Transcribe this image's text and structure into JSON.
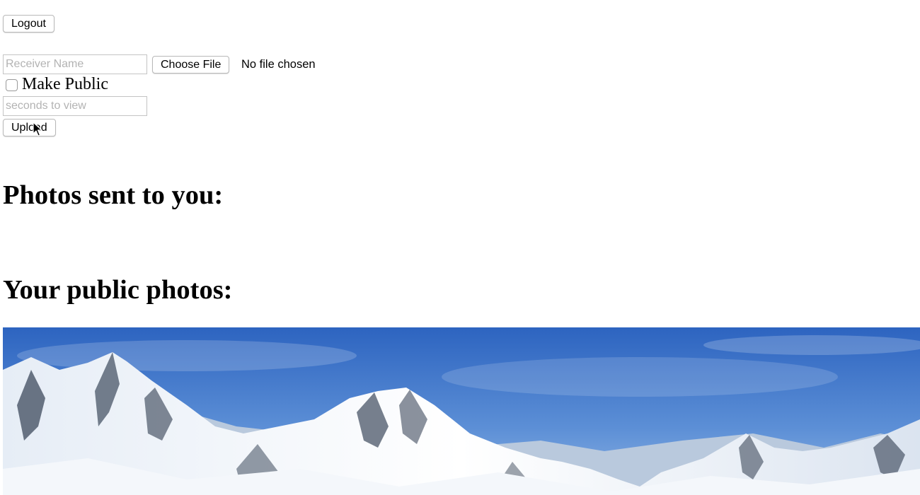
{
  "toolbar": {
    "logout_label": "Logout"
  },
  "upload_form": {
    "receiver_placeholder": "Receiver Name",
    "choose_file_label": "Choose File",
    "file_status": "No file chosen",
    "make_public_label": "Make Public",
    "make_public_checked": false,
    "seconds_placeholder": "seconds to view",
    "upload_label": "Upload"
  },
  "sections": {
    "received_heading": "Photos sent to you:",
    "public_heading": "Your public photos:"
  },
  "public_photos": [
    {
      "subject": "snow-capped mountain range under blue sky"
    }
  ],
  "colors": {
    "sky_top": "#2f6fc4",
    "sky_bottom": "#7fa9dd",
    "snow": "#f4f7fb",
    "rock": "#3d4a5c"
  }
}
